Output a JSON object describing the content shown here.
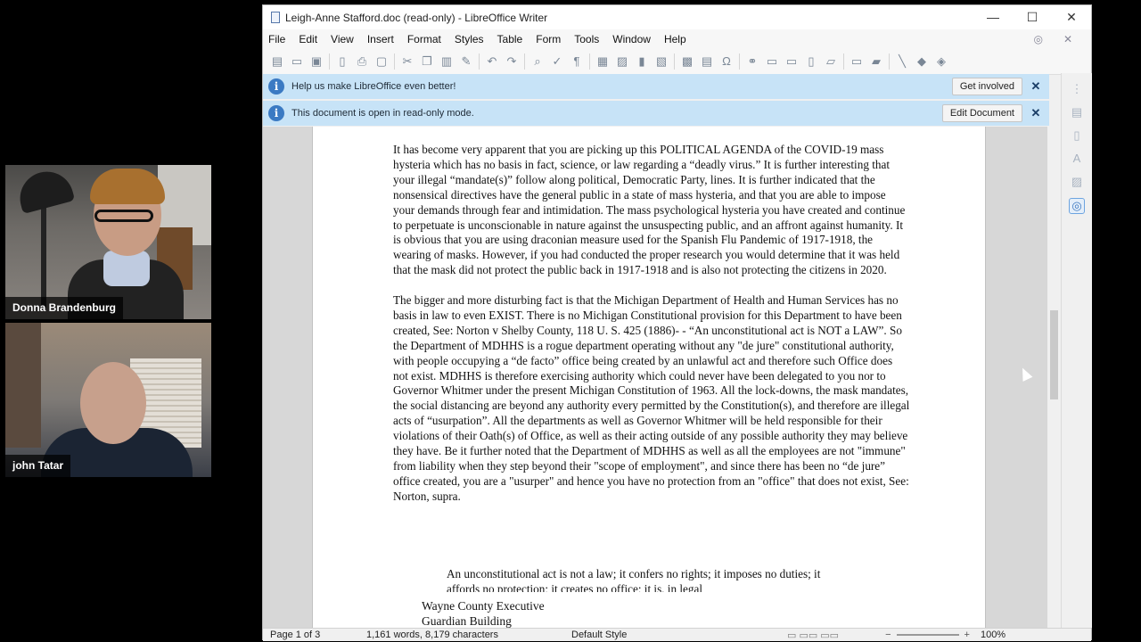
{
  "participants": [
    {
      "name": "Donna Brandenburg"
    },
    {
      "name": "john Tatar"
    }
  ],
  "window": {
    "title": "Leigh-Anne Stafford.doc (read-only) - LibreOffice Writer",
    "controls": {
      "minimize": "—",
      "maximize": "☐",
      "close": "✕"
    }
  },
  "menu": [
    "File",
    "Edit",
    "View",
    "Insert",
    "Format",
    "Styles",
    "Table",
    "Form",
    "Tools",
    "Window",
    "Help"
  ],
  "infobars": [
    {
      "text": "Help us make LibreOffice even better!",
      "button": "Get involved"
    },
    {
      "text": "This document is open in read-only mode.",
      "button": "Edit Document"
    }
  ],
  "document": {
    "paragraphs": [
      "It has become very apparent that you are picking up this POLITICAL AGENDA of the COVID-19 mass hysteria which has no basis in fact, science, or law regarding a “deadly virus.” It is further interesting that your illegal “mandate(s)” follow along political, Democratic Party, lines. It is further indicated that the nonsensical directives have the general public in a state of mass hysteria, and that you are able to impose your demands through fear and intimidation.  The mass psychological hysteria you have created and continue to perpetuate is unconscionable in nature against the unsuspecting public, and an affront against humanity.  It is obvious that you are using draconian measure used for the Spanish Flu Pandemic of 1917-1918, the wearing of masks. However, if you had conducted the proper research you would determine that it was held that the mask did not protect the public back in 1917-1918 and is also not protecting the citizens in 2020.",
      "The bigger and more disturbing fact is that the Michigan Department of Health and Human Services has no basis in law to even EXIST.  There is no Michigan Constitutional provision for this Department to have been created,  See: Norton v Shelby County, 118 U. S. 425 (1886)- - “An unconstitutional act is NOT a LAW”.   So the Department of MDHHS is a rogue department operating without any \"de jure\" constitutional authority, with people occupying a “de facto” office being created by an unlawful act and therefore such Office does not exist.  MDHHS is therefore exercising authority which could never have been delegated to you nor to Governor Whitmer under the present Michigan Constitution of 1963.  All the lock-downs, the mask mandates, the social distancing are beyond any authority every permitted by the Constitution(s), and therefore are illegal acts of “usurpation”.  All the departments as well as Governor Whitmer will be held responsible for their violations of their Oath(s) of Office,  as well as their acting outside of any possible authority they may believe they have.  Be it further noted that the Department of MDHHS as well as all the employees are not \"immune\" from liability when they step beyond their \"scope of employment\", and since there has been no “de jure” office created, you are a \"usurper\" and hence you have no protection from an \"office\" that does not exist, See: Norton, supra."
    ],
    "quote": "An unconstitutional act is not a law; it confers no rights; it imposes no duties; it affords no protection; it creates no office; it is, in legal",
    "address": [
      "Wayne County Executive",
      "Guardian Building"
    ]
  },
  "status": {
    "page": "Page 1 of 3",
    "words": "1,161 words, 8,179 characters",
    "style": "Default Style",
    "zoom": "100%"
  }
}
